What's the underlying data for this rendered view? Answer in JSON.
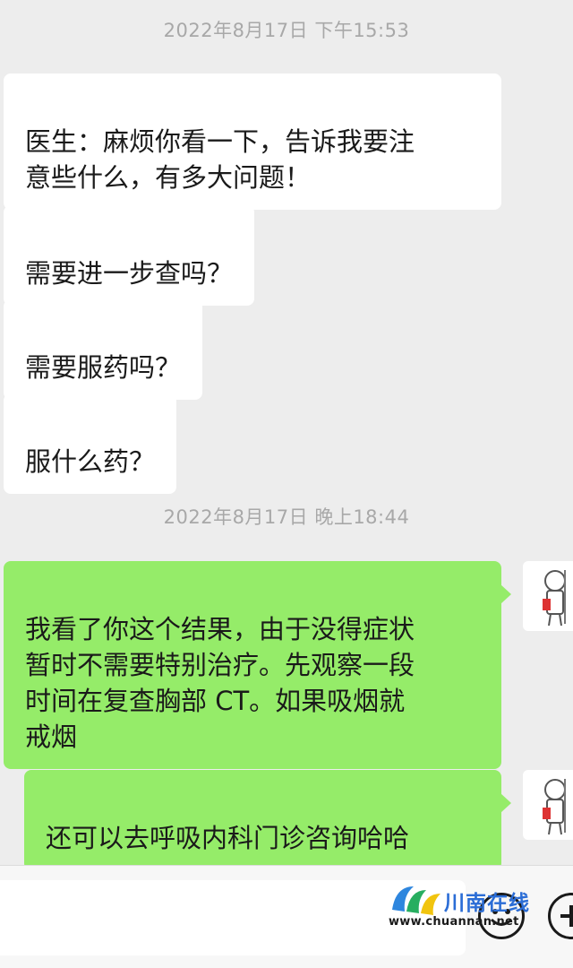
{
  "conversation": {
    "timestamps": [
      "2022年8月17日 下午15:53",
      "2022年8月17日 晚上18:44"
    ],
    "messages": [
      {
        "side": "in",
        "text": "医生：麻烦你看一下，告诉我要注\n意些什么，有多大问题！"
      },
      {
        "side": "in",
        "text": "需要进一步查吗？"
      },
      {
        "side": "in",
        "text": "需要服药吗？"
      },
      {
        "side": "in",
        "text": "服什么药？"
      },
      {
        "side": "out",
        "text": "我看了你这个结果，由于没得症状\n暂时不需要特别治疗。先观察一段\n时间在复查胸部 CT。如果吸烟就\n戒烟"
      },
      {
        "side": "out",
        "text": "还可以去呼吸内科门诊咨询哈哈"
      }
    ]
  },
  "colors": {
    "background": "#ededed",
    "incoming_bubble": "#ffffff",
    "outgoing_bubble": "#95ec69",
    "timestamp_text": "#a8a8a8"
  },
  "watermark": {
    "name": "川南在线",
    "url": "www.chuannan.net"
  },
  "input_bar": {
    "icons": [
      "emoji-icon",
      "plus-icon"
    ]
  }
}
